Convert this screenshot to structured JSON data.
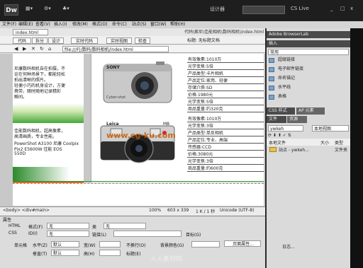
{
  "app": {
    "logo": "Dw",
    "top_right": [
      "设计器",
      "CS Live"
    ],
    "window_ctrl": [
      "_",
      "□",
      "x"
    ]
  },
  "menus": [
    "文件(F)",
    "编辑(E)",
    "查看(V)",
    "插入(I)",
    "修改(M)",
    "格式(O)",
    "命令(C)",
    "站点(S)",
    "窗口(W)",
    "帮助(H)"
  ],
  "document": {
    "tab": "index.html",
    "path": "代码\\索尼\\佳能相机\\数码相机\\index.html",
    "views": [
      "代码",
      "拆分",
      "设计",
      "实时代码",
      "实时视图",
      "检查",
      "标题: 无标题文档"
    ],
    "address": "file:///F|/数码/数码相机/index.html"
  },
  "left_column_texts": [
    "尼康数码相机自在拍摄，不",
    "论在何种场景下，都能轻松",
    "拍出清晰的照片。",
    "轻便小巧的机身设计，方便",
    "携带，随时随地记录精彩",
    "瞬间。",
    "佳能数码相机，超高像素，",
    "高清画质，专业性能。",
    "PowerShot A3100  尼康 Coolpix",
    "Pix2 E5600W  佳能 EOS",
    "550D"
  ],
  "products": [
    {
      "brand": "SONY",
      "model": "Cyber-shot",
      "specs": [
        "有效像素:1010万",
        "光学变焦:5倍",
        "产品类型:卡片相机",
        "产品定位:家用、轻便",
        "存储介质:SD",
        "价格:1980元",
        "光学变焦:5倍",
        "商品重量:约320克"
      ]
    },
    {
      "brand": "Leica",
      "model": "M8",
      "specs": [
        "有效像素:1010万",
        "光学变焦:3倍",
        "产品类型:单反相机",
        "产品定位:专业、高端",
        "传感器:CCD",
        "价格:3080元",
        "光学变焦:3倍",
        "商品重量:约600克"
      ]
    }
  ],
  "status": {
    "tags": "<body> <div#main>",
    "zoom": "100%",
    "size": "603 x 339",
    "weight": "1 K / 1 秒",
    "encoding": "Unicode (UTF-8)"
  },
  "properties": {
    "title": "属性",
    "html_label": "HTML",
    "css_label": "CSS",
    "format_label": "格式(F)",
    "format_value": "无",
    "class_label": "类",
    "class_value": "无",
    "id_label": "ID(I)",
    "id_value": "无",
    "link_label": "链接(L)",
    "target_label": "目标(G)",
    "cell_label": "单元格",
    "horz_label": "水平(Z)",
    "horz_value": "默认",
    "vert_label": "垂直(T)",
    "vert_value": "默认",
    "w_label": "宽(W)",
    "h_label": "高(H)",
    "nowrap_label": "不换行(O)",
    "bg_label": "背景颜色(G)",
    "header_label": "标题(E)",
    "page_props": "页面属性..."
  },
  "panel": {
    "header": "Adobe BrowserLab",
    "insert_tab": "插入",
    "insert_category": "常用",
    "insert_items": [
      "超级链接",
      "电子邮件链接",
      "命名锚记",
      "水平线",
      "表格"
    ],
    "css_tabs": [
      "CSS 样式",
      "AP 元素"
    ],
    "files_tabs": [
      "文件",
      "资源"
    ],
    "site": "ywkeh",
    "view": "本地视图",
    "file_header": [
      "本地文件",
      "大小",
      "类型"
    ],
    "file_row": [
      "站点 - ywkeh...",
      "",
      "文件夹"
    ],
    "log": "日志..."
  },
  "watermark": "www.cg-ku.com",
  "watermark2": "人人素材网"
}
